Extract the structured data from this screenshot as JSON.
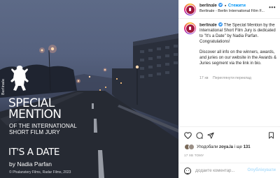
{
  "photo": {
    "logo_word": "Berlinale",
    "title": "SPECIAL\nMENTION",
    "subtitle": "OF THE INTERNATIONAL\nSHORT FILM JURY",
    "film_title": "IT'S A DATE",
    "director": "by Nadia Parfan",
    "copyright": "© Phalanstery Films, Radar Films, 2023"
  },
  "header": {
    "username": "berlinale",
    "follow_label": "Стежити",
    "subtitle": "Berlinale - Berlin International Film F...",
    "more_icon": "more-horizontal-icon"
  },
  "caption": {
    "username": "berlinale",
    "text_1": "The Special Mention by the International Short Film Jury is dedicated to \"It's a Date\" by Nadia Parfan. Congratulations!",
    "text_2": "Discover all info on the winners, awards, and juries on our website in the Awards & Juries segment via the link in bio.",
    "time": "17 хв",
    "translate_label": "Переглянути переклад"
  },
  "actions": {
    "icons": [
      "heart-icon",
      "comment-icon",
      "share-icon",
      "bookmark-icon"
    ]
  },
  "likes": {
    "prefix": "Уподобали ",
    "user": "zoya.la",
    "suffix": " і ще ",
    "count": "131"
  },
  "time_ago": "17 ХВ ТОМУ",
  "comment": {
    "placeholder": "Додайте коментар...",
    "publish_label": "Опублікувати"
  },
  "colors": {
    "accent": "#0095f6",
    "publish_disabled": "#b2dffc",
    "verified": "#3897f0"
  }
}
